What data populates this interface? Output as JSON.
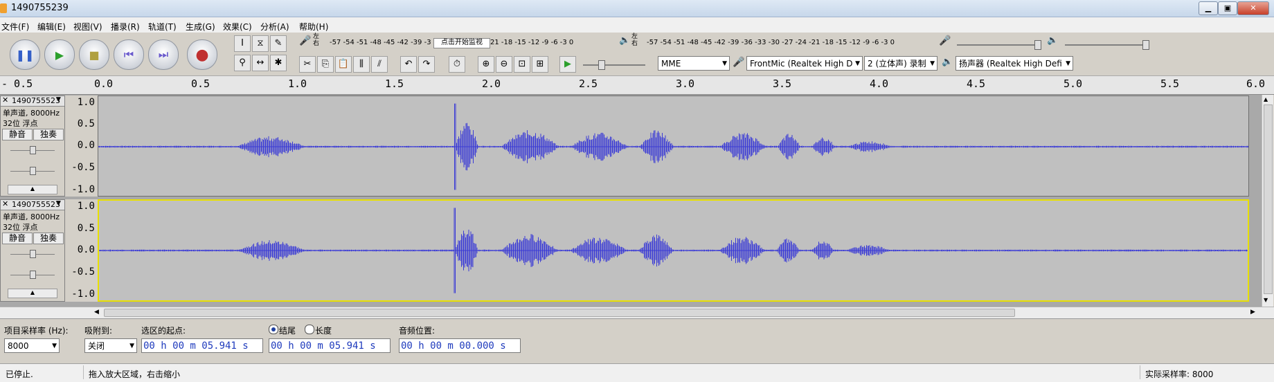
{
  "window": {
    "title": "1490755239"
  },
  "menu": [
    "文件(F)",
    "编辑(E)",
    "视图(V)",
    "播录(R)",
    "轨道(T)",
    "生成(G)",
    "效果(C)",
    "分析(A)",
    "帮助(H)"
  ],
  "toolbar": {
    "record_meter_scale": "-57 -54 -51 -48 -45 -42 -39 -3",
    "record_meter_hint": "点击开始监视",
    "record_meter_scale_right": "21 -18 -15 -12  -9  -6  -3  0",
    "play_meter_scale": "-57 -54 -51 -48 -45 -42 -39 -36 -33 -30 -27 -24 -21 -18 -15 -12  -9  -6  -3  0",
    "meter_lr_top": "左",
    "meter_lr_bottom": "右",
    "host": "MME",
    "input_device": "FrontMic (Realtek High D",
    "channels": "2 (立体声) 录制",
    "output_device": "扬声器 (Realtek High Defi"
  },
  "ruler": {
    "labels": [
      "- 0.5",
      "0.0",
      "0.5",
      "1.0",
      "1.5",
      "2.0",
      "2.5",
      "3.0",
      "3.5",
      "4.0",
      "4.5",
      "5.0",
      "5.5",
      "6.0"
    ]
  },
  "tracks": [
    {
      "name": "1490755523",
      "info1": "单声道, 8000Hz",
      "info2": "32位 浮点",
      "mute": "静音",
      "solo": "独奏",
      "scale": [
        "1.0",
        "0.5",
        "0.0",
        "-0.5",
        "-1.0"
      ]
    },
    {
      "name": "1490755523",
      "info1": "单声道, 8000Hz",
      "info2": "32位 浮点",
      "mute": "静音",
      "solo": "独奏",
      "scale": [
        "1.0",
        "0.5",
        "0.0",
        "-0.5",
        "-1.0"
      ]
    }
  ],
  "selection": {
    "rate_label": "项目采样率 (Hz):",
    "rate_value": "8000",
    "snap_label": "吸附到:",
    "snap_value": "关闭",
    "start_label": "选区的起点:",
    "end_radio": "结尾",
    "length_radio": "长度",
    "start_time": "00 h 00 m 05.941 s",
    "end_time": "00 h 00 m 05.941 s",
    "pos_label": "音频位置:",
    "pos_time": "00 h 00 m 00.000 s"
  },
  "status": {
    "left": "已停止.",
    "hint": "拖入放大区域，右击缩小",
    "rate": "实际采样率: 8000"
  },
  "colors": {
    "waveform": "#3a3ad6",
    "trackbg": "#c0c0c0",
    "selected_border": "#e8e000"
  }
}
